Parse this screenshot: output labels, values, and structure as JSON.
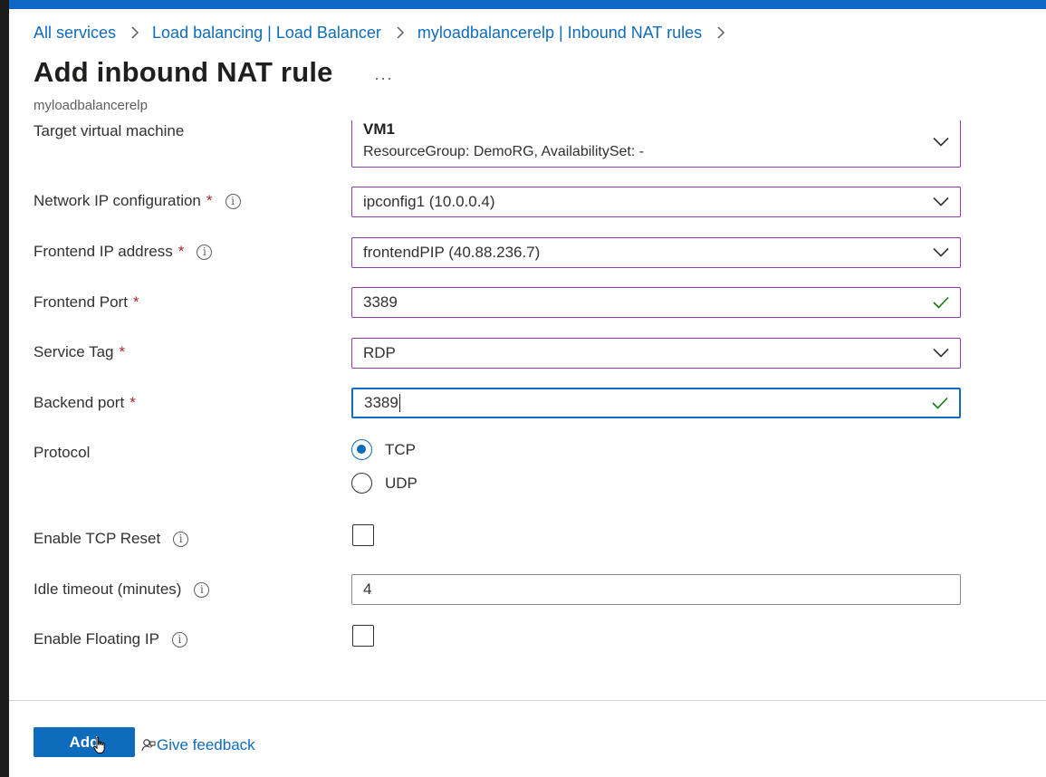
{
  "breadcrumb": {
    "items": [
      "All services",
      "Load balancing | Load Balancer",
      "myloadbalancerelp | Inbound NAT rules"
    ]
  },
  "page": {
    "title": "Add inbound NAT rule",
    "more": "···",
    "subtitle": "myloadbalancerelp"
  },
  "form": {
    "target_vm": {
      "label": "Target virtual machine",
      "value_line1": "VM1",
      "value_line2": "ResourceGroup: DemoRG, AvailabilitySet: -"
    },
    "network_ip": {
      "label": "Network IP configuration",
      "required": "*",
      "value": "ipconfig1 (10.0.0.4)"
    },
    "frontend_ip": {
      "label": "Frontend IP address",
      "required": "*",
      "value": "frontendPIP (40.88.236.7)"
    },
    "frontend_port": {
      "label": "Frontend Port",
      "required": "*",
      "value": "3389"
    },
    "service_tag": {
      "label": "Service Tag",
      "required": "*",
      "value": "RDP"
    },
    "backend_port": {
      "label": "Backend port",
      "required": "*",
      "value": "3389"
    },
    "protocol": {
      "label": "Protocol",
      "options": [
        "TCP",
        "UDP"
      ],
      "selected": "TCP"
    },
    "tcp_reset": {
      "label": "Enable TCP Reset",
      "checked": false
    },
    "idle_timeout": {
      "label": "Idle timeout (minutes)",
      "value": "4"
    },
    "floating_ip": {
      "label": "Enable Floating IP",
      "checked": false
    }
  },
  "footer": {
    "add_label": "Add",
    "feedback_label": "Give feedback"
  },
  "icons": {
    "info": "info-icon",
    "dropdown": "chevron-down-icon",
    "valid": "checkmark-icon",
    "breadcrumb_sep": "chevron-right-icon",
    "feedback": "feedback-person-icon"
  },
  "colors": {
    "accent": "#0f6cbd",
    "input_border": "#8a3ea5",
    "required": "#a4262c",
    "valid": "#107c10",
    "topbar": "#0e68c4"
  }
}
